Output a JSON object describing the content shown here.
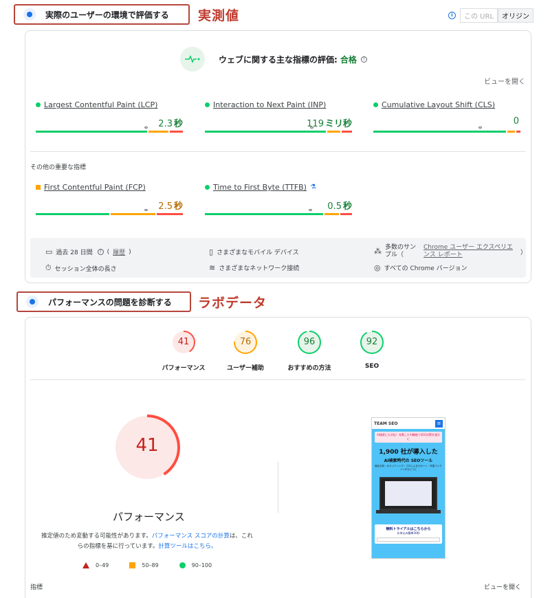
{
  "field": {
    "section_title": "実際のユーザーの環境で評価する",
    "annotation": "実測値",
    "url_toggle": {
      "this_url": "この URL",
      "origin": "オリジン"
    },
    "assessment_label": "ウェブに関する主な指標の評価:",
    "assessment_result": "合格",
    "expand_view": "ビューを開く",
    "core_metrics": [
      {
        "name": "Largest Contentful Paint (LCP)",
        "value": "2.3",
        "unit": "秒",
        "status": "good",
        "distribution": [
          0.77,
          0.14,
          0.09
        ],
        "marker": 0.75
      },
      {
        "name": "Interaction to Next Paint (INP)",
        "value": "119",
        "unit": "ミリ秒",
        "status": "good",
        "distribution": [
          0.84,
          0.09,
          0.07
        ],
        "marker": 0.73
      },
      {
        "name": "Cumulative Layout Shift (CLS)",
        "value": "0",
        "unit": "",
        "status": "good",
        "distribution": [
          0.92,
          0.05,
          0.03
        ],
        "marker": 0.73
      }
    ],
    "other_heading": "その他の重要な指標",
    "other_metrics": [
      {
        "name": "First Contentful Paint (FCP)",
        "value": "2.5",
        "unit": "秒",
        "status": "average",
        "distribution": [
          0.51,
          0.31,
          0.18
        ],
        "marker": 0.75
      },
      {
        "name": "Time to First Byte (TTFB)",
        "value": "0.5",
        "unit": "秒",
        "status": "good",
        "distribution": [
          0.82,
          0.1,
          0.08
        ],
        "marker": 0.72
      }
    ],
    "footer": {
      "period": "過去 28 日間",
      "history": "履歴",
      "session": "セッション全体の長さ",
      "devices": "さまざまなモバイル デバイス",
      "network": "さまざまなネットワーク接続",
      "samples_prefix": "多数のサン",
      "samples_prefix2": "プル（",
      "samples_link": "Chrome ユーザー エクスペリエンス レポート",
      "samples_suffix": "）",
      "versions": "すべての Chrome バージョン"
    }
  },
  "lab": {
    "section_title": "パフォーマンスの問題を診断する",
    "annotation": "ラボデータ",
    "scores": [
      {
        "label": "パフォーマンス",
        "value": 41,
        "color": "#ff4e42",
        "fill": "#fce8e6",
        "text": "#c5221f"
      },
      {
        "label": "ユーザー補助",
        "value": 76,
        "color": "#ffa400",
        "fill": "#fff3e0",
        "text": "#b56c00"
      },
      {
        "label": "おすすめの方法",
        "value": 96,
        "color": "#0cce6b",
        "fill": "#e6f4ea",
        "text": "#188038"
      },
      {
        "label": "SEO",
        "value": 92,
        "color": "#0cce6b",
        "fill": "#e6f4ea",
        "text": "#188038"
      }
    ],
    "main_score": 41,
    "main_label": "パフォーマンス",
    "desc_1": "推定値のため変動する可能性があります。",
    "desc_link_1": "パフォーマンス スコアの計算",
    "desc_2": "は、これらの指標を基に行っています。",
    "desc_link_2": "計算ツールはこちら。",
    "legend": {
      "poor": "0–49",
      "average": "50–89",
      "good": "90–100"
    },
    "metrics_heading": "指標",
    "expand_view": "ビューを開く",
    "preview": {
      "logo": "TEAM SEO",
      "ribbon": "AI検索にも対応！充実したAI機能でSEO対策を強力に",
      "headline": "1,900 社が導入した",
      "subhead": "AI検索時代の SEOツール",
      "tagline": "競合分析・AIライティング・プロによるサポート・学習コンテンツがひとつに",
      "cta_title": "無料トライアルはこちらから",
      "cta_sub": "お申込み簡単30秒"
    }
  },
  "colors": {
    "good": "#0cce6b",
    "average": "#ffa400",
    "poor": "#ff4e42",
    "annotation": "#c0392b"
  }
}
